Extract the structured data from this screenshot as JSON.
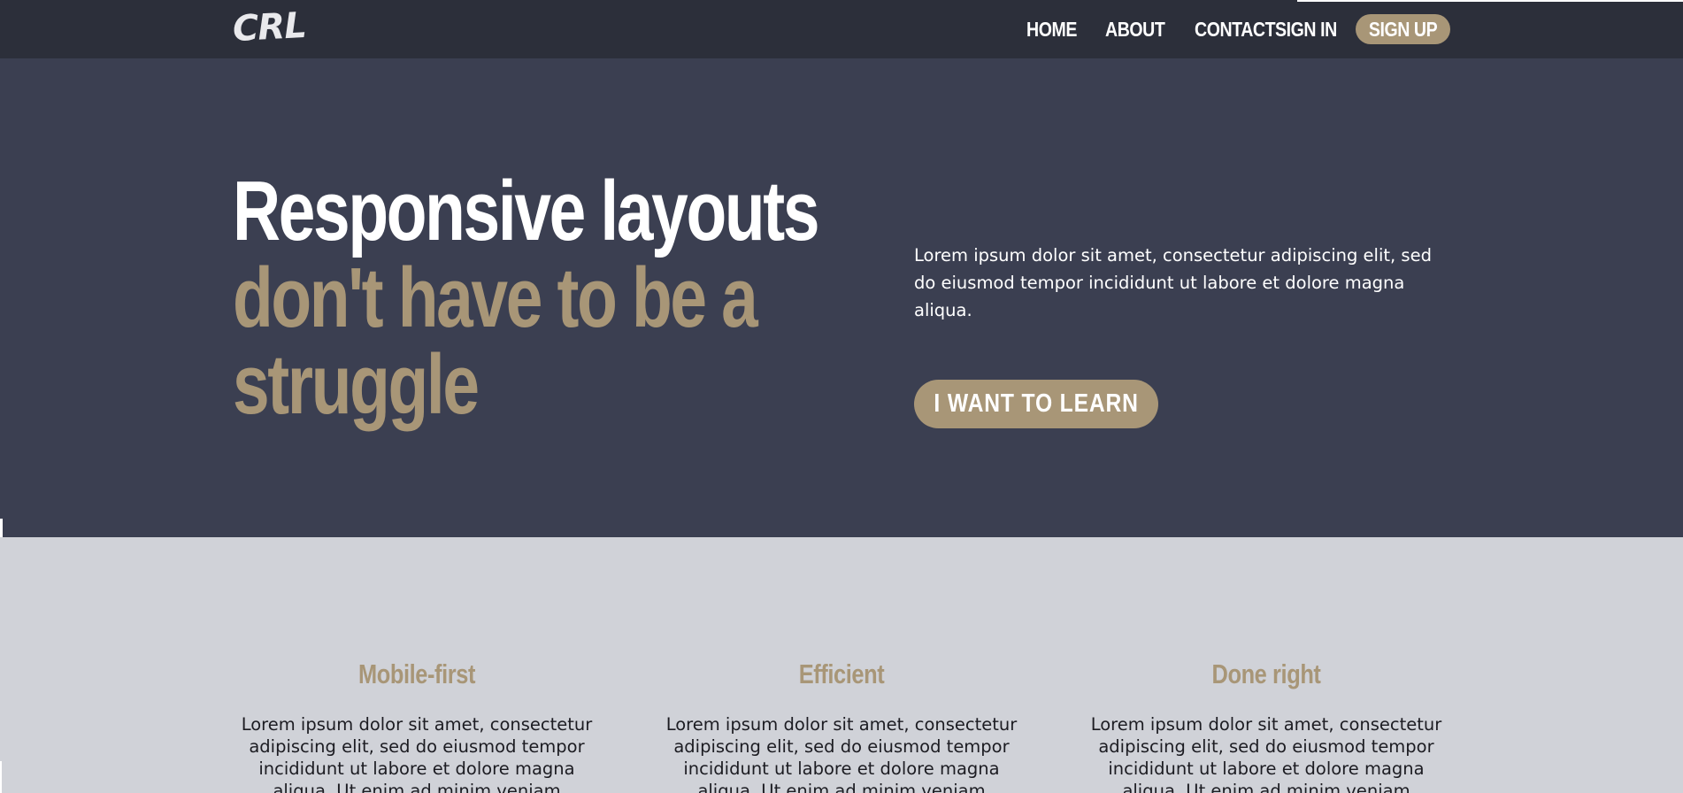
{
  "brand": {
    "logo": "CRL"
  },
  "nav": {
    "items": [
      {
        "label": "HOME"
      },
      {
        "label": "ABOUT"
      },
      {
        "label": "CONTACT"
      }
    ],
    "sign_in": "SIGN IN",
    "sign_up": "SIGN UP"
  },
  "hero": {
    "title_line1": "Responsive layouts",
    "title_line2": "don't have to be a",
    "title_line3": "struggle",
    "text": "Lorem ipsum dolor sit amet, consectetur adipiscing elit, sed do eiusmod tempor incididunt ut labore et dolore magna aliqua.",
    "cta": "I WANT TO LEARN"
  },
  "features": [
    {
      "title": "Mobile-first",
      "text": "Lorem ipsum dolor sit amet, consectetur adipiscing elit, sed do eiusmod tempor incididunt ut labore et dolore magna aliqua. Ut enim ad minim veniam"
    },
    {
      "title": "Efficient",
      "text": "Lorem ipsum dolor sit amet, consectetur adipiscing elit, sed do eiusmod tempor incididunt ut labore et dolore magna aliqua. Ut enim ad minim veniam"
    },
    {
      "title": "Done right",
      "text": "Lorem ipsum dolor sit amet, consectetur adipiscing elit, sed do eiusmod tempor incididunt ut labore et dolore magna aliqua. Ut enim ad minim veniam"
    }
  ],
  "colors": {
    "header_bg": "#2c2f3a",
    "hero_bg": "#3b3f51",
    "accent": "#a89677",
    "section_bg": "#d0d2d8"
  }
}
